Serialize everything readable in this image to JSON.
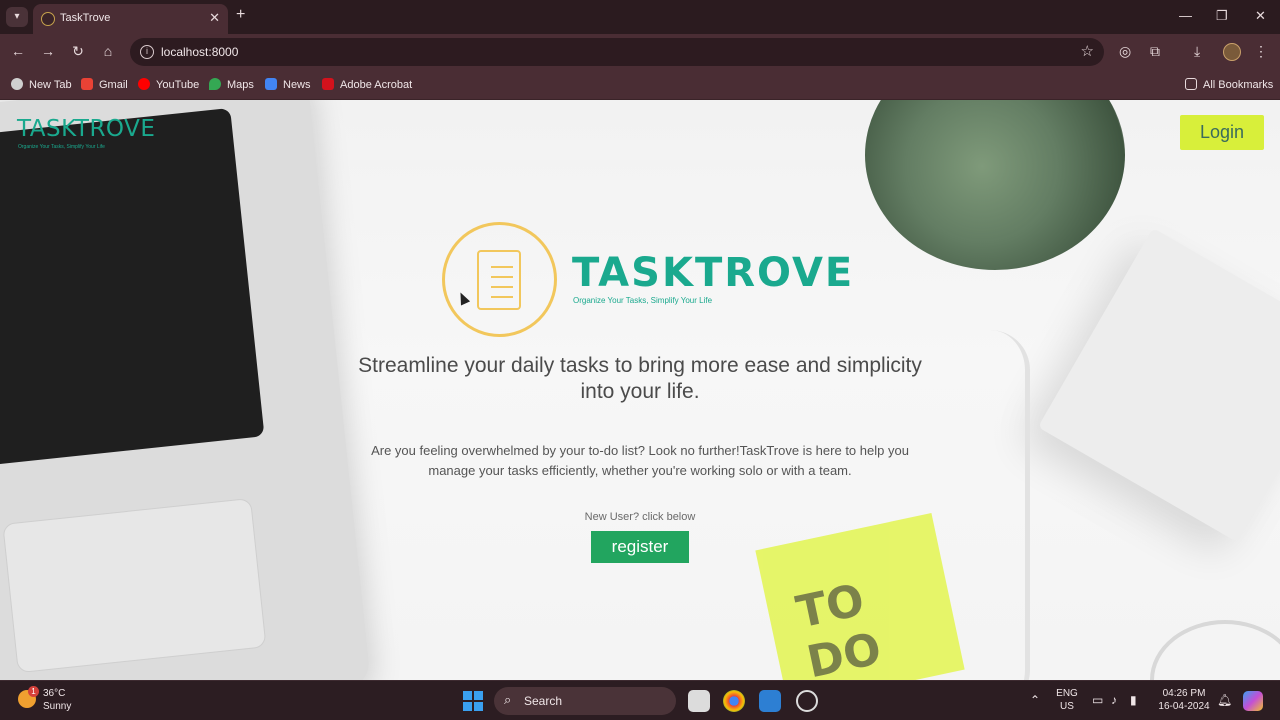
{
  "browser": {
    "tab_title": "TaskTrove",
    "url": "localhost:8000",
    "bookmarks": [
      "New Tab",
      "Gmail",
      "YouTube",
      "Maps",
      "News",
      "Adobe Acrobat"
    ],
    "all_bookmarks": "All Bookmarks"
  },
  "page": {
    "logo": "TASKTROVE",
    "logo_tagline": "Organize Your Tasks, Simplify Your Life",
    "login": "Login",
    "hero_title": "TASKTROVE",
    "hero_tagline": "Organize Your Tasks, Simplify Your Life",
    "headline": "Streamline your daily tasks to bring more ease and simplicity into your life.",
    "body": "Are you feeling overwhelmed by your to-do list? Look no further!TaskTrove is here to help you manage your tasks efficiently, whether you're working solo or with a team.",
    "new_user": "New User? click below",
    "register": "register",
    "sticky_note": "TO DO"
  },
  "taskbar": {
    "weather_temp": "36°C",
    "weather_cond": "Sunny",
    "weather_badge": "1",
    "search": "Search",
    "lang": "ENG",
    "region": "US",
    "time": "04:26 PM",
    "date": "16-04-2024"
  },
  "colors": {
    "brand_teal": "#1aa98e",
    "login_yellow": "#d8ef3a",
    "register_green": "#22a55f",
    "browser_frame": "#4a2d34"
  }
}
